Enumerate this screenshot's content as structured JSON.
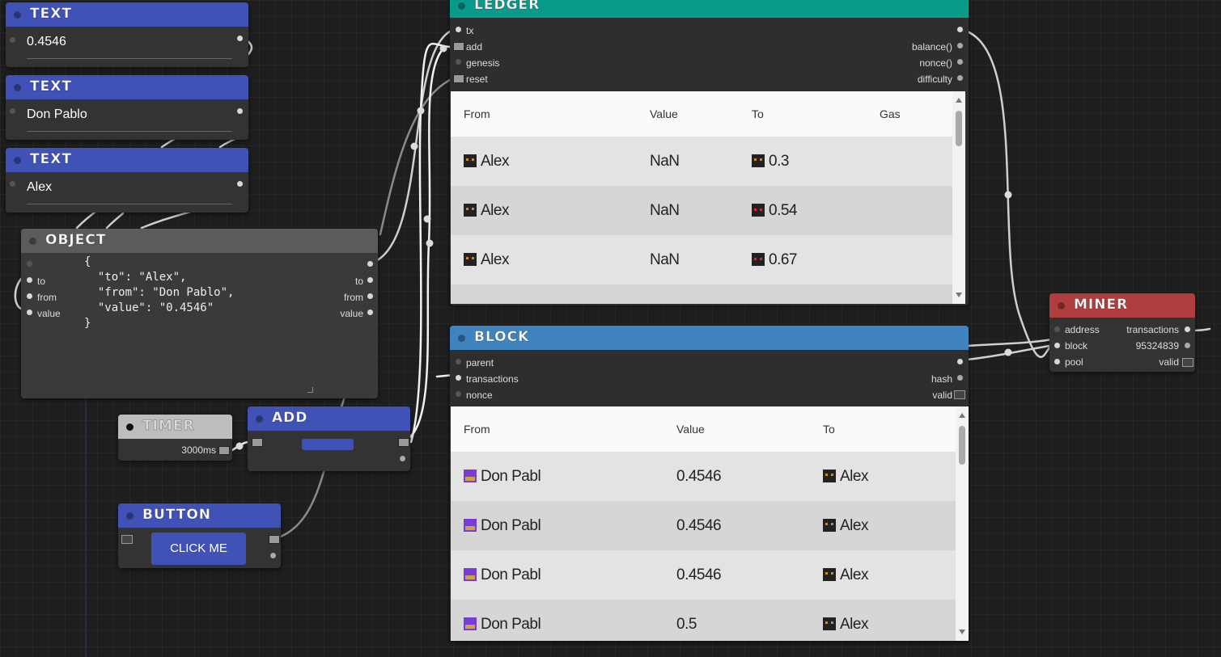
{
  "colors": {
    "text": "#4052b5",
    "ledger": "#0a9a8a",
    "object": "#5b5b5b",
    "timer": "#bdbdbd",
    "block": "#3f84bf",
    "miner": "#b03e3e"
  },
  "text_nodes": [
    {
      "title": "TEXT",
      "value": "0.4546"
    },
    {
      "title": "TEXT",
      "value": "Don Pablo"
    },
    {
      "title": "TEXT",
      "value": "Alex"
    }
  ],
  "object_node": {
    "title": "OBJECT",
    "inputs": [
      "to",
      "from",
      "value"
    ],
    "outputs": [
      "to",
      "from",
      "value"
    ],
    "json": "{\n  \"to\": \"Alex\",\n  \"from\": \"Don Pablo\",\n  \"value\": \"0.4546\"\n}"
  },
  "timer_node": {
    "title": "TIMER",
    "interval": "3000ms"
  },
  "add_node": {
    "title": "ADD"
  },
  "button_node": {
    "title": "BUTTON",
    "button_label": "CLICK ME"
  },
  "ledger_node": {
    "title": "LEDGER",
    "inputs": [
      "tx",
      "add",
      "genesis",
      "reset"
    ],
    "outputs": [
      "balance()",
      "nonce()",
      "difficulty"
    ],
    "columns": [
      "From",
      "Value",
      "To",
      "Gas"
    ],
    "rows": [
      {
        "from": "Alex",
        "value": "NaN",
        "to": "0.3",
        "gas": ""
      },
      {
        "from": "Alex",
        "value": "NaN",
        "to": "0.54",
        "gas": ""
      },
      {
        "from": "Alex",
        "value": "NaN",
        "to": "0.67",
        "gas": ""
      }
    ]
  },
  "block_node": {
    "title": "BLOCK",
    "inputs": [
      "parent",
      "transactions",
      "nonce"
    ],
    "outputs": [
      "hash",
      "valid"
    ],
    "columns": [
      "From",
      "Value",
      "To"
    ],
    "rows": [
      {
        "from": "Don Pabl",
        "value": "0.4546",
        "to": "Alex"
      },
      {
        "from": "Don Pabl",
        "value": "0.4546",
        "to": "Alex"
      },
      {
        "from": "Don Pabl",
        "value": "0.4546",
        "to": "Alex"
      },
      {
        "from": "Don Pabl",
        "value": "0.5",
        "to": "Alex"
      }
    ]
  },
  "miner_node": {
    "title": "MINER",
    "inputs": [
      "address",
      "block",
      "pool"
    ],
    "outputs": [
      "transactions",
      "95324839",
      "valid"
    ]
  }
}
